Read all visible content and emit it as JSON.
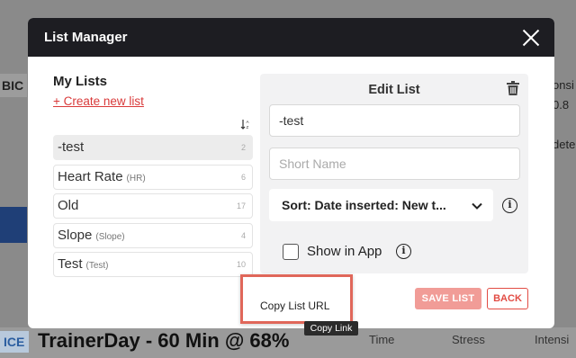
{
  "background": {
    "left_badge": "BIC",
    "right_col": [
      "onsi",
      "0.8",
      "",
      "dete"
    ],
    "ice_badge": "ICE",
    "workout_title": "TrainerDay - 60 Min @ 68%",
    "stats": [
      "Time",
      "Stress",
      "Intensi"
    ]
  },
  "modal": {
    "title": "List Manager",
    "my_lists_heading": "My Lists",
    "create_link": "+ Create new list",
    "sort_icon": "sort-az-icon",
    "lists": [
      {
        "name": "-test",
        "short": "",
        "count": "2"
      },
      {
        "name": "Heart Rate",
        "short": "(HR)",
        "count": "6"
      },
      {
        "name": "Old",
        "short": "",
        "count": "17"
      },
      {
        "name": "Slope",
        "short": "(Slope)",
        "count": "4"
      },
      {
        "name": "Test",
        "short": "(Test)",
        "count": "10"
      }
    ],
    "edit": {
      "title": "Edit List",
      "name_value": "-test",
      "short_name_placeholder": "Short Name",
      "sort_label": "Sort: Date inserted: New t...",
      "show_in_app_label": "Show in App"
    },
    "save_label": "SAVE LIST",
    "back_label": "BACK"
  },
  "popup": {
    "item": "Copy List URL",
    "tooltip": "Copy Link"
  },
  "colors": {
    "header_bg": "#1d1d22",
    "accent_red": "#d93a3a",
    "save_bg": "#f19c97",
    "popup_border": "#e0675a"
  }
}
